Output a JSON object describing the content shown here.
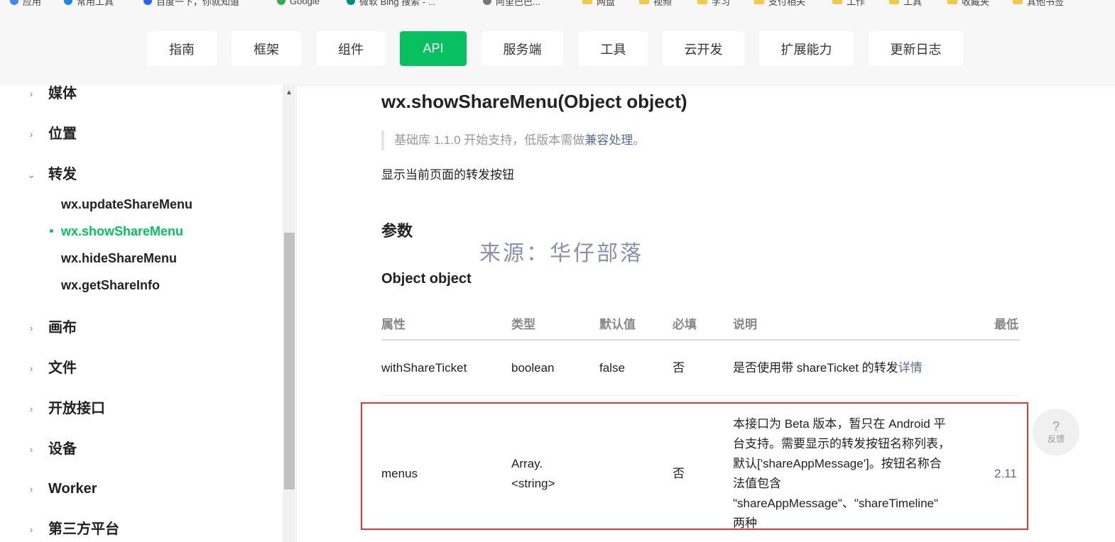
{
  "bookmarks": {
    "items": [
      {
        "label": "应用"
      },
      {
        "label": "常用工具"
      },
      {
        "label": "百度一下，你就知道"
      },
      {
        "label": "Google"
      },
      {
        "label": "微软 Bing 搜索 - ..."
      },
      {
        "label": "阿里巴巴..."
      },
      {
        "label": "网盘"
      },
      {
        "label": "视频"
      },
      {
        "label": "学习"
      },
      {
        "label": "支付相关"
      },
      {
        "label": "工作"
      },
      {
        "label": "工具"
      },
      {
        "label": "收藏夹"
      },
      {
        "label": "其他书签"
      }
    ]
  },
  "nav": {
    "items": [
      {
        "label": "指南"
      },
      {
        "label": "框架"
      },
      {
        "label": "组件"
      },
      {
        "label": "API"
      },
      {
        "label": "服务端"
      },
      {
        "label": "工具"
      },
      {
        "label": "云开发"
      },
      {
        "label": "扩展能力"
      },
      {
        "label": "更新日志"
      }
    ],
    "active_index": 3,
    "accent_color": "#07c160"
  },
  "sidebar": {
    "groups_before": [
      {
        "label": "媒体",
        "icon": "chevron-right-icon"
      },
      {
        "label": "位置",
        "icon": "chevron-right-icon"
      }
    ],
    "open_group": {
      "label": "转发",
      "icon": "chevron-down-icon"
    },
    "sub_items": [
      {
        "label": "wx.updateShareMenu",
        "active": false
      },
      {
        "label": "wx.showShareMenu",
        "active": true
      },
      {
        "label": "wx.hideShareMenu",
        "active": false
      },
      {
        "label": "wx.getShareInfo",
        "active": false
      }
    ],
    "groups_after": [
      {
        "label": "画布",
        "icon": "chevron-right-icon"
      },
      {
        "label": "文件",
        "icon": "chevron-right-icon"
      },
      {
        "label": "开放接口",
        "icon": "chevron-right-icon"
      },
      {
        "label": "设备",
        "icon": "chevron-right-icon"
      },
      {
        "label": "Worker",
        "icon": "chevron-right-icon"
      },
      {
        "label": "第三方平台",
        "icon": "chevron-right-icon"
      }
    ]
  },
  "content": {
    "title": "wx.showShareMenu(Object object)",
    "note_prefix": "基础库 1.1.0 开始支持，低版本需做",
    "note_link": "兼容处理",
    "note_suffix": "。",
    "description": "显示当前页面的转发按钮",
    "params_heading": "参数",
    "watermark": "来源：华仔部落",
    "object_heading": "Object object",
    "table": {
      "headers": [
        "属性",
        "类型",
        "默认值",
        "必填",
        "说明",
        "最低"
      ],
      "rows": [
        {
          "property": "withShareTicket",
          "type": "boolean",
          "default": "false",
          "required": "否",
          "desc_text": "是否使用带 shareTicket 的转发",
          "desc_link": "详情",
          "min_version": ""
        },
        {
          "property": "menus",
          "type_line1": "Array.",
          "type_line2": "<string>",
          "default": "",
          "required": "否",
          "desc_lines": [
            "本接口为 Beta 版本，暂只在 Android 平",
            "台支持。需要显示的转发按钮名称列表，",
            "默认['shareAppMessage']。按钮名称合",
            "法值包含",
            "\"shareAppMessage\"、\"shareTimeline\"",
            "两种"
          ],
          "min_version": "2.11"
        }
      ]
    }
  },
  "feedback": {
    "icon": "?",
    "label": "反馈"
  },
  "colors": {
    "link": "#576b95",
    "highlight_border": "#e53935"
  }
}
